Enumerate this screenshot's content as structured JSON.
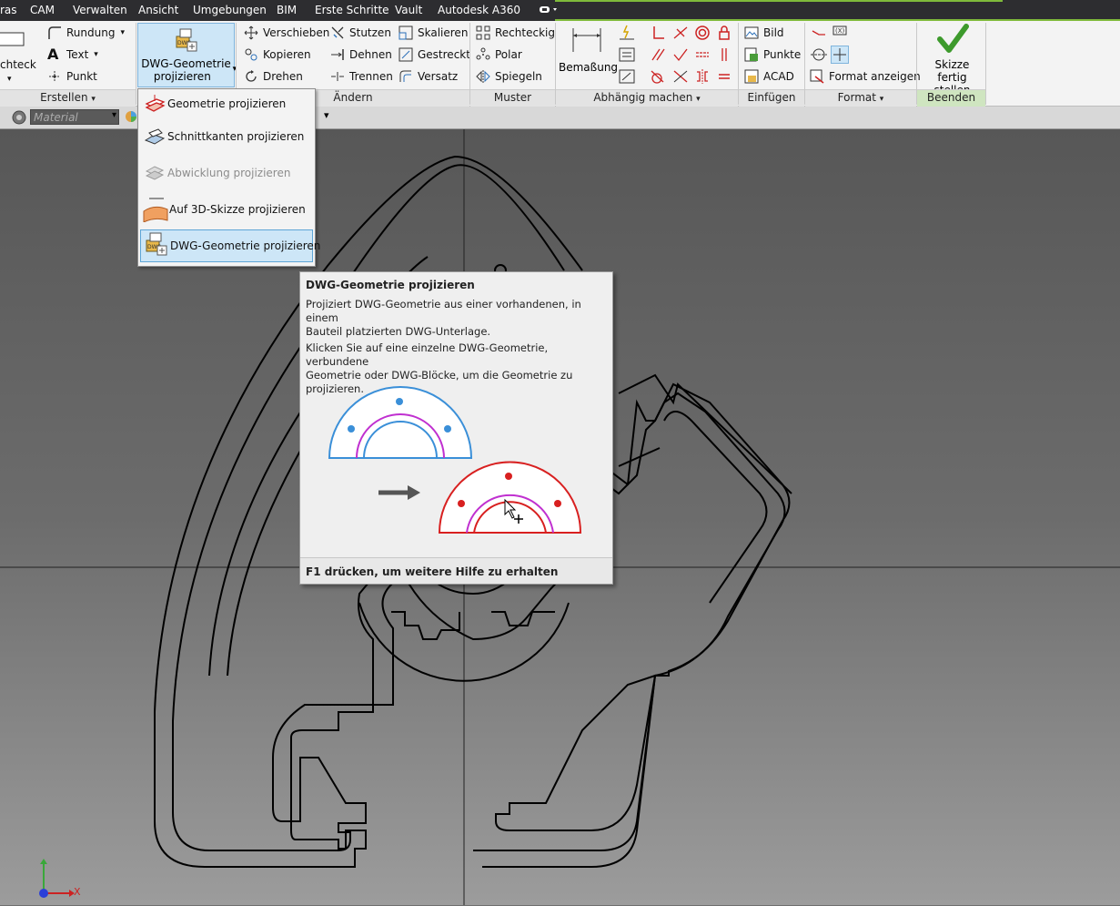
{
  "menu": [
    "ras",
    "CAM",
    "Verwalten",
    "Ansicht",
    "Umgebungen",
    "BIM",
    "Erste Schritte",
    "Vault",
    "Autodesk A360"
  ],
  "ribbon": {
    "erstellen": {
      "rechteck": "chteck",
      "rundung": "Rundung",
      "text": "Text",
      "punkt": "Punkt",
      "footer": "Erstellen"
    },
    "dwg_button": {
      "line1": "DWG-Geometrie",
      "line2": "projizieren"
    },
    "aendern": {
      "verschieben": "Verschieben",
      "kopieren": "Kopieren",
      "drehen": "Drehen",
      "stutzen": "Stutzen",
      "dehnen": "Dehnen",
      "trennen": "Trennen",
      "skalieren": "Skalieren",
      "gestreckt": "Gestreckt",
      "versatz": "Versatz",
      "footer": "Ändern"
    },
    "muster": {
      "rechteckig": "Rechteckig",
      "polar": "Polar",
      "spiegeln": "Spiegeln",
      "footer": "Muster"
    },
    "abhaengig": {
      "bemassung": "Bemaßung",
      "footer": "Abhängig machen"
    },
    "einfuegen": {
      "bild": "Bild",
      "punkte": "Punkte",
      "acad": "ACAD",
      "footer": "Einfügen"
    },
    "format": {
      "format_anzeigen": "Format anzeigen",
      "footer": "Format"
    },
    "beenden": {
      "line1": "Skizze",
      "line2": "fertig stellen",
      "footer": "Beenden"
    }
  },
  "toolbar": {
    "material_placeholder": "Material"
  },
  "dropdown": [
    {
      "label": "Geometrie projizieren"
    },
    {
      "label": "Schnittkanten projizieren"
    },
    {
      "label": "Abwicklung projizieren"
    },
    {
      "label": "Auf 3D-Skizze projizieren"
    },
    {
      "label": "DWG-Geometrie  projizieren"
    }
  ],
  "tooltip": {
    "title": "DWG-Geometrie projizieren",
    "p1_line1": "Projiziert DWG-Geometrie aus einer vorhandenen, in einem",
    "p1_line2": "Bauteil platzierten DWG-Unterlage.",
    "p2_line1": "Klicken Sie auf eine einzelne DWG-Geometrie, verbundene",
    "p2_line2": "Geometrie oder DWG-Blöcke, um die Geometrie zu projizieren.",
    "footer": "F1 drücken, um weitere Hilfe zu erhalten"
  },
  "colors": {
    "accent_green": "#7fba3b",
    "hover_blue": "#cde6f7",
    "tooltip_bg": "#efefef"
  },
  "axis": {
    "x_label": "X"
  }
}
